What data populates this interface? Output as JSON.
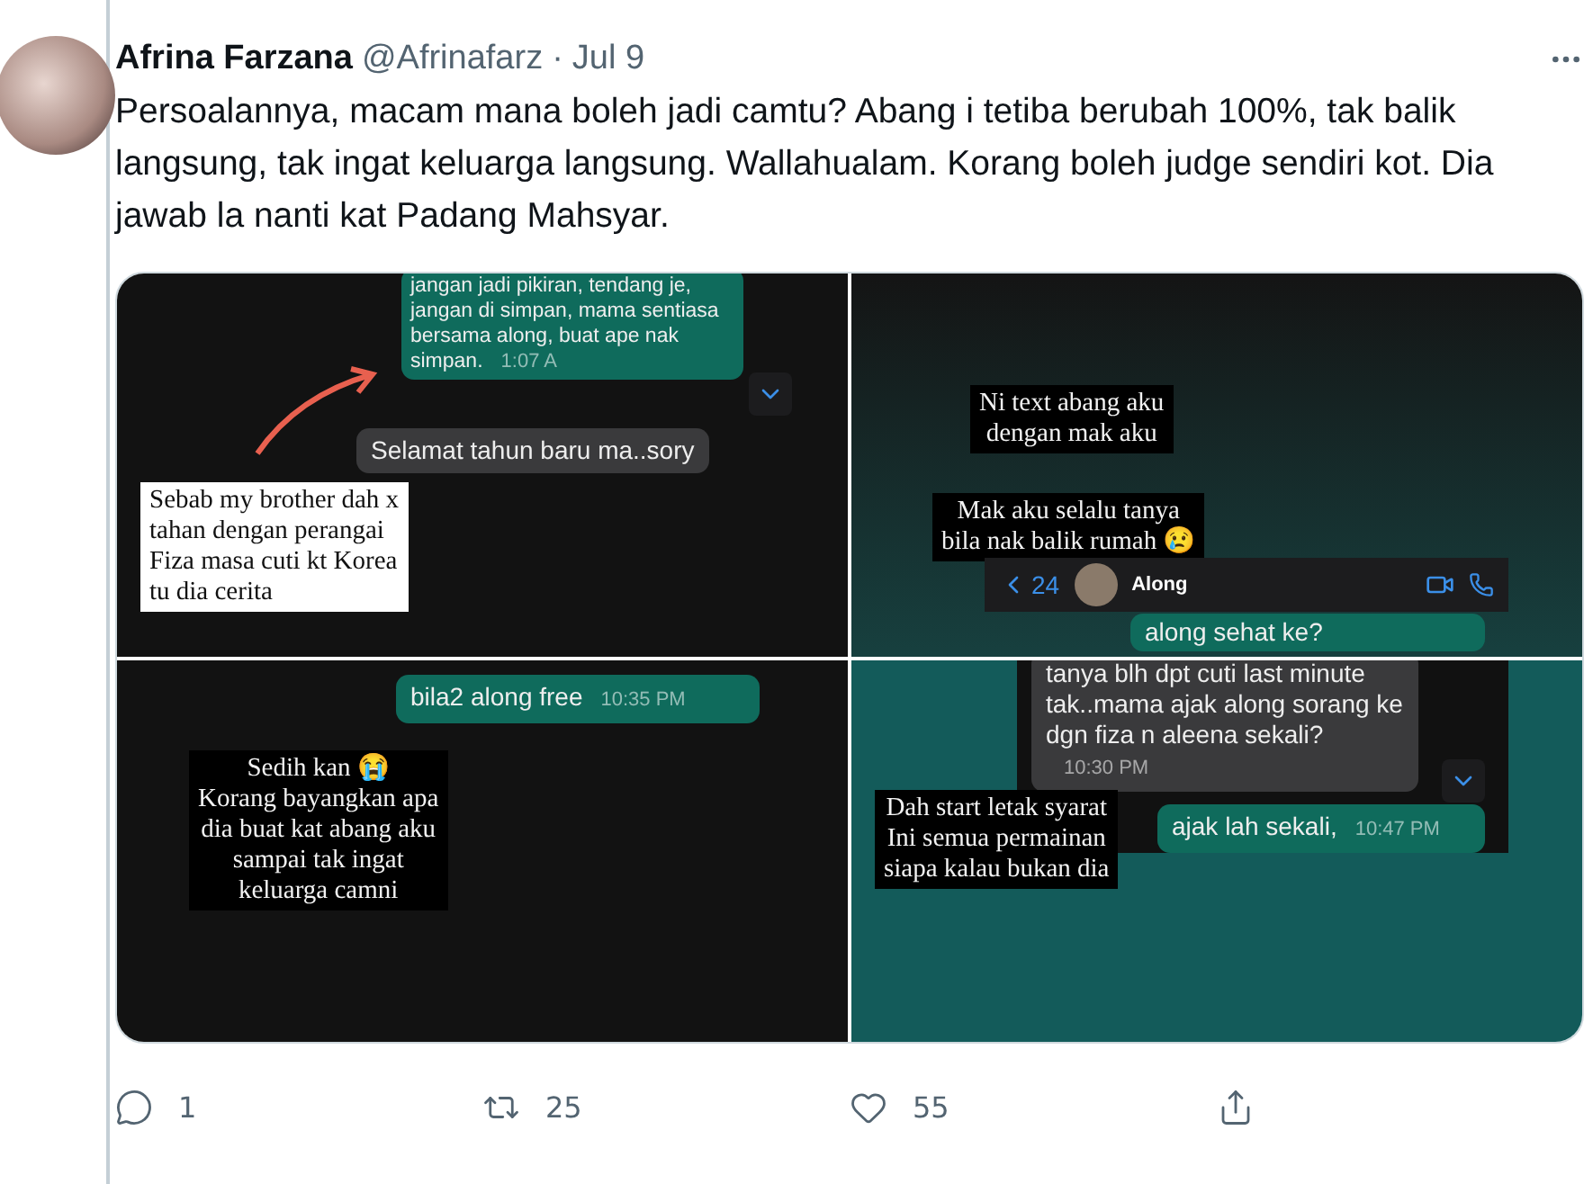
{
  "author": {
    "name": "Afrina Farzana",
    "handle": "@Afrinafarz",
    "separator": "·",
    "date": "Jul 9"
  },
  "text": "Persoalannya, macam mana boleh jadi camtu? Abang i tetiba berubah 100%, tak balik langsung, tak ingat keluarga langsung. Wallahualam. Korang boleh judge sendiri kot. Dia jawab la nanti kat Padang Mahsyar.",
  "media": [
    {
      "kind": "dark",
      "items": [
        {
          "kind": "sent",
          "text": "jangan jadi pikiran, tendang je, jangan di simpan, mama sentiasa bersama along, buat ape nak simpan.",
          "time": "1:07 A"
        },
        {
          "kind": "scroll_button"
        },
        {
          "kind": "received",
          "text": "Selamat tahun baru ma..sory"
        },
        {
          "kind": "arrow"
        },
        {
          "kind": "light_caption",
          "lines": [
            "Sebab my brother dah x",
            "tahan dengan perangai",
            "Fiza masa cuti kt Korea",
            "tu dia cerita"
          ]
        }
      ]
    },
    {
      "kind": "gradient",
      "items": [
        {
          "kind": "caption",
          "lines": [
            "Ni text abang aku",
            "dengan mak aku"
          ]
        },
        {
          "kind": "caption",
          "lines": [
            "Mak aku selalu tanya",
            "bila nak balik rumah 😢"
          ]
        },
        {
          "kind": "chat_header",
          "count": "24",
          "name": "Along"
        },
        {
          "kind": "sent",
          "text": "along sehat ke?"
        }
      ]
    },
    {
      "kind": "dark",
      "items": [
        {
          "kind": "sent",
          "text": "bila2 along free",
          "time": "10:35 PM"
        },
        {
          "kind": "caption",
          "lines": [
            "Sedih kan 😭",
            "Korang bayangkan apa",
            "dia buat kat abang aku",
            "sampai tak ingat",
            "keluarga camni"
          ]
        }
      ]
    },
    {
      "kind": "teal",
      "items": [
        {
          "kind": "chat_strip"
        },
        {
          "kind": "received",
          "text": "tanya blh dpt cuti last minute tak..mama ajak along sorang ke dgn fiza n aleena sekali?",
          "time": "10:30 PM"
        },
        {
          "kind": "scroll_button"
        },
        {
          "kind": "caption",
          "lines": [
            "Dah start letak syarat",
            "Ini semua permainan",
            "siapa kalau bukan dia"
          ]
        },
        {
          "kind": "sent",
          "text": "ajak lah sekali,",
          "time": "10:47 PM"
        }
      ]
    }
  ],
  "actions": [
    {
      "kind": "reply",
      "count": "1"
    },
    {
      "kind": "retweet",
      "count": "25"
    },
    {
      "kind": "like",
      "count": "55"
    },
    {
      "kind": "share"
    }
  ]
}
